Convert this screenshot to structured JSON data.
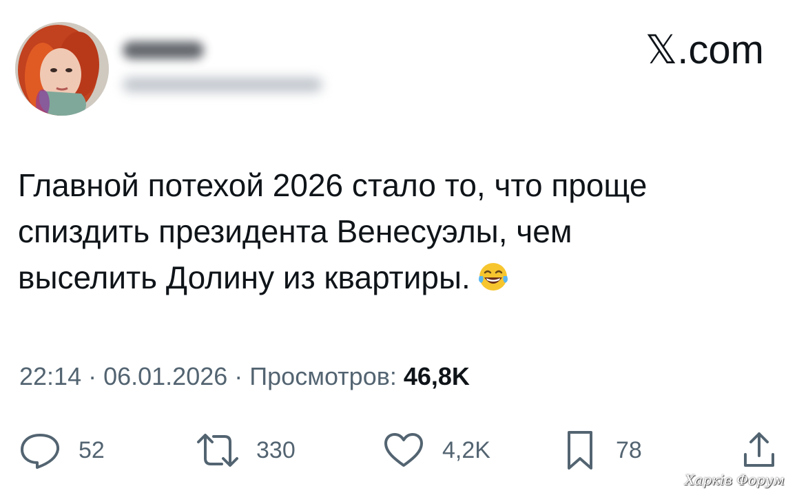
{
  "header": {
    "brand": "𝕏.com"
  },
  "tweet": {
    "lines": [
      "Главной потехой 2026 стало то, что проще",
      "спиздить президента Венесуэлы, чем",
      "выселить Долину из квартиры."
    ],
    "emoji": "face-with-tears-of-joy"
  },
  "meta": {
    "time": "22:14",
    "separator": " · ",
    "date": "06.01.2026",
    "views_label": "Просмотров:",
    "views_count": "46,8K"
  },
  "actions": {
    "replies": {
      "icon": "reply-icon",
      "count": "52"
    },
    "reposts": {
      "icon": "repost-icon",
      "count": "330"
    },
    "likes": {
      "icon": "heart-icon",
      "count": "4,2K"
    },
    "bookmarks": {
      "icon": "bookmark-icon",
      "count": "78"
    },
    "share": {
      "icon": "share-icon"
    }
  },
  "watermark": "Харків Форум",
  "colors": {
    "text": "#0f1419",
    "secondary": "#536471",
    "background": "#ffffff"
  }
}
